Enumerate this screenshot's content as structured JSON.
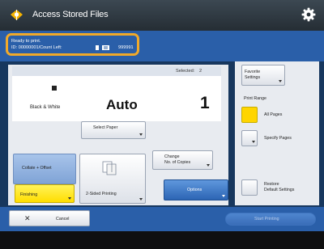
{
  "titlebar": {
    "title": "Access Stored Files",
    "app_icon": "printer-status-icon",
    "settings_icon": "gear-icon"
  },
  "status": {
    "line1": "Ready to print.",
    "line2": "ID: 00000001/Count Left:",
    "counter_value": "999991",
    "icons": [
      "printer-icon",
      "counter-icon"
    ],
    "highlight_color": "#f0a92a"
  },
  "summary": {
    "selected_label": "Selected:",
    "selected_count": "2",
    "color_mode": "Black & White",
    "paper": "Auto",
    "copies": "1"
  },
  "buttons": {
    "select_paper": "Select Paper",
    "change_copies": [
      "Change",
      "No. of Copies"
    ],
    "collate": "Collate + Offset",
    "finishing": "Finishing",
    "two_sided": "2-Sided Printing",
    "options": "Options"
  },
  "side": {
    "favorite_settings": [
      "Favorite",
      "Settings"
    ],
    "print_range_label": "Print Range",
    "all_pages": "All Pages",
    "specify_pages": "Specify Pages",
    "restore_defaults": [
      "Restore",
      "Default Settings"
    ]
  },
  "bottom": {
    "cancel": "Cancel",
    "start_printing": "Start Printing"
  },
  "colors": {
    "panel_blue": "#2a5fa9",
    "accent_yellow": "#ffd500",
    "options_blue": "#2c65b4"
  }
}
